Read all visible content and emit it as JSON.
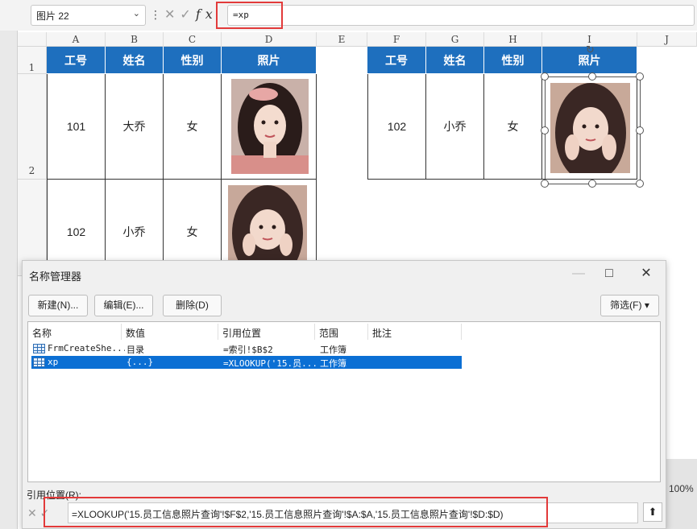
{
  "formula_bar": {
    "name_box": "图片 22",
    "formula": "=xp"
  },
  "columns": [
    "A",
    "B",
    "C",
    "D",
    "E",
    "F",
    "G",
    "H",
    "I",
    "J"
  ],
  "rows": [
    "1",
    "2"
  ],
  "table_left": {
    "headers": [
      "工号",
      "姓名",
      "性别",
      "照片"
    ],
    "rows": [
      [
        "101",
        "大乔",
        "女"
      ],
      [
        "102",
        "小乔",
        "女"
      ]
    ]
  },
  "table_right": {
    "headers": [
      "工号",
      "姓名",
      "性别",
      "照片"
    ],
    "rows": [
      [
        "102",
        "小乔",
        "女"
      ]
    ]
  },
  "dialog": {
    "title": "名称管理器",
    "buttons": {
      "new": "新建(N)...",
      "edit": "编辑(E)...",
      "delete": "删除(D)",
      "filter": "筛选(F) ▾"
    },
    "columns": [
      "名称",
      "数值",
      "引用位置",
      "范围",
      "批注"
    ],
    "items": [
      {
        "name": "FrmCreateShe...",
        "value": "目录",
        "ref": "=索引!$B$2",
        "scope": "工作簿"
      },
      {
        "name": "xp",
        "value": "{...}",
        "ref": "=XLOOKUP('15.员...",
        "scope": "工作簿"
      }
    ],
    "ref_label": "引用位置(R):",
    "ref_value": "=XLOOKUP('15.员工信息照片查询'!$F$2,'15.员工信息照片查询'!$A:$A,'15.员工信息照片查询'!$D:$D)"
  },
  "status": {
    "zoom": "100%"
  },
  "colors": {
    "header_blue": "#1e6fbe",
    "highlight_red": "#e23a3a",
    "selection_blue": "#0b6fd4"
  }
}
